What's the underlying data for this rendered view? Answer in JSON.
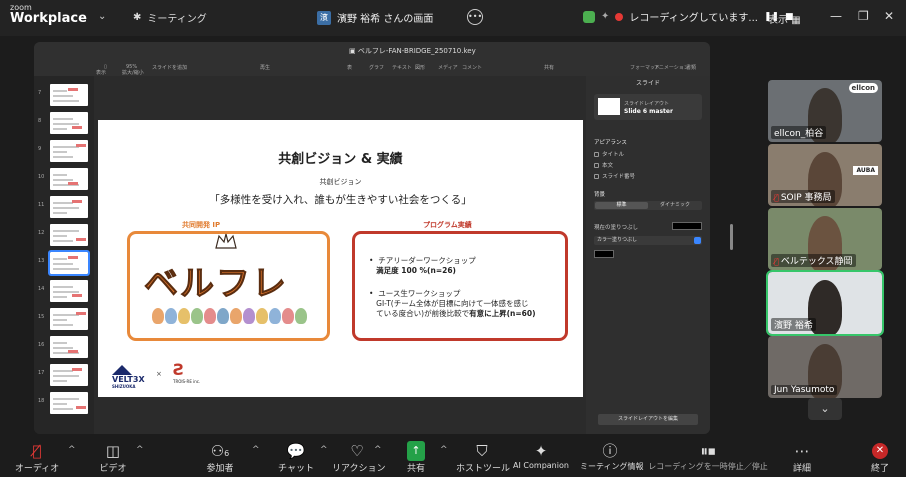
{
  "titlebar": {
    "app_top": "zoom",
    "app_name": "Workplace",
    "meeting_icon": "people-icon",
    "meeting_label": "ミーティング",
    "screen_badge": "濱",
    "screen_title": "濱野 裕希 さんの画面",
    "recording_status": "レコーディングしています...",
    "pause_ctl": "❚❚",
    "stop_ctl": "■",
    "view_label": "表示"
  },
  "keynote": {
    "file_name": "ベルフレ-FAN-BRIDGE_250710.key",
    "zoom_level": "95%",
    "tools": [
      "表示",
      "拡大/縮小",
      "スライドを追加",
      "再生",
      "表",
      "グラフ",
      "テキスト",
      "図形",
      "メディア",
      "コメント",
      "共有",
      "フォーマット",
      "アニメーション",
      "書類"
    ],
    "slide_numbers": [
      "7",
      "8",
      "9",
      "10",
      "11",
      "12",
      "13",
      "14",
      "15",
      "16",
      "17",
      "18"
    ]
  },
  "slide": {
    "title": "共創ビジョン & 実績",
    "subtitle": "共創ビジョン",
    "quote": "「多様性を受け入れ、誰もが生きやすい社会をつくる」",
    "ip_label": "共同開発 IP",
    "program_label": "プログラム実績",
    "mascot_text": "ベルフレ",
    "program_items": [
      {
        "line1": "チアリーダーワークショップ",
        "line2_bold": "満足度 100 %(n=26)"
      },
      {
        "line1": "ユース生ワークショップ",
        "line2": "GI-T(チーム全体が目標に向けて一体感を感じ",
        "line3_pre": "ている度合い)が前後比較で",
        "line3_bold": "有意に上昇(n=60)"
      }
    ],
    "logo_left": "VELT3X",
    "logo_left_sub": "SHIZUOKA",
    "logo_x": "×",
    "logo_right": "Ƨ",
    "logo_right_sub": "TROIS-RE inc."
  },
  "inspector": {
    "header": "スライド",
    "layout_caption": "スライドレイアウト",
    "layout_name": "Slide 6 master",
    "appearance": "アピアランス",
    "opt_title": "タイトル",
    "opt_body": "本文",
    "opt_number": "スライド番号",
    "background": "背景",
    "seg_standard": "標準",
    "seg_dynamic": "ダイナミック",
    "fill_label": "現在の塗りつぶし",
    "color_fill": "カラー塗りつぶし",
    "edit_layout": "スライドレイアウトを編集"
  },
  "participants": [
    {
      "name": "ellcon_柏谷",
      "muted": false
    },
    {
      "name": "SOIP 事務局",
      "muted": true
    },
    {
      "name": "ベルテックス静岡",
      "muted": true
    },
    {
      "name": "濱野 裕希",
      "muted": false
    },
    {
      "name": "Jun Yasumoto",
      "muted": false
    }
  ],
  "gallery_badges": {
    "ellcon": "ellcon",
    "auba": "AUBA"
  },
  "toolbar": {
    "audio": "オーディオ",
    "video": "ビデオ",
    "participants": "参加者",
    "participants_count": "6",
    "chat": "チャット",
    "reaction": "リアクション",
    "share": "共有",
    "host_tools": "ホストツール",
    "ai": "AI Companion",
    "info": "ミーティング情報",
    "record": "レコーディングを一時停止／停止",
    "more": "詳細",
    "end": "終了"
  },
  "colors": {
    "accent_orange": "#e8893a",
    "accent_red": "#c0392b",
    "share_green": "#24a148",
    "active_speaker": "#36c66a",
    "recording_red": "#e53935"
  }
}
